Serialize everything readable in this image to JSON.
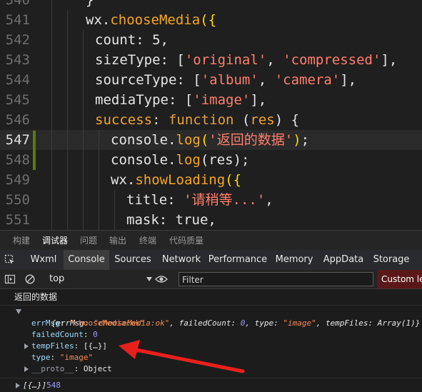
{
  "editor": {
    "lines": [
      {
        "num": "540",
        "tokens": [
          {
            "t": "}",
            "c": "p"
          }
        ]
      },
      {
        "num": "541",
        "tokens": [
          {
            "t": "wx.",
            "c": "p"
          },
          {
            "t": "chooseMedia",
            "c": "f"
          },
          {
            "t": "({",
            "c": "br"
          }
        ]
      },
      {
        "num": "542",
        "tokens": [
          {
            "t": "count",
            "c": "pr"
          },
          {
            "t": ": ",
            "c": "p"
          },
          {
            "t": "5",
            "c": "n"
          },
          {
            "t": ",",
            "c": "p"
          }
        ]
      },
      {
        "num": "543",
        "tokens": [
          {
            "t": "sizeType",
            "c": "pr"
          },
          {
            "t": ": [",
            "c": "p"
          },
          {
            "t": "'original'",
            "c": "s"
          },
          {
            "t": ", ",
            "c": "p"
          },
          {
            "t": "'compressed'",
            "c": "s"
          },
          {
            "t": "],",
            "c": "p"
          }
        ]
      },
      {
        "num": "544",
        "tokens": [
          {
            "t": "sourceType",
            "c": "pr"
          },
          {
            "t": ": [",
            "c": "p"
          },
          {
            "t": "'album'",
            "c": "s"
          },
          {
            "t": ", ",
            "c": "p"
          },
          {
            "t": "'camera'",
            "c": "s"
          },
          {
            "t": "],",
            "c": "p"
          }
        ]
      },
      {
        "num": "545",
        "tokens": [
          {
            "t": "mediaType",
            "c": "pr"
          },
          {
            "t": ": [",
            "c": "p"
          },
          {
            "t": "'image'",
            "c": "s"
          },
          {
            "t": "],",
            "c": "p"
          }
        ]
      },
      {
        "num": "546",
        "tokens": [
          {
            "t": "success",
            "c": "f"
          },
          {
            "t": ": ",
            "c": "p"
          },
          {
            "t": "function",
            "c": "kw"
          },
          {
            "t": " (",
            "c": "p"
          },
          {
            "t": "res",
            "c": "f"
          },
          {
            "t": ") {",
            "c": "p"
          }
        ]
      },
      {
        "num": "547",
        "tokens": [
          {
            "t": "console.",
            "c": "p"
          },
          {
            "t": "log",
            "c": "f"
          },
          {
            "t": "(",
            "c": "br"
          },
          {
            "t": "'返回的数据'",
            "c": "s"
          },
          {
            "t": ")",
            "c": "br"
          },
          {
            "t": ";",
            "c": "p"
          }
        ]
      },
      {
        "num": "548",
        "tokens": [
          {
            "t": "console.",
            "c": "p"
          },
          {
            "t": "log",
            "c": "f"
          },
          {
            "t": "(res);",
            "c": "p"
          }
        ]
      },
      {
        "num": "549",
        "tokens": [
          {
            "t": "wx.",
            "c": "p"
          },
          {
            "t": "showLoading",
            "c": "f"
          },
          {
            "t": "({",
            "c": "br"
          }
        ]
      },
      {
        "num": "550",
        "tokens": [
          {
            "t": "title",
            "c": "pr"
          },
          {
            "t": ": ",
            "c": "p"
          },
          {
            "t": "'请稍等...'",
            "c": "s"
          },
          {
            "t": ",",
            "c": "p"
          }
        ]
      },
      {
        "num": "551",
        "tokens": [
          {
            "t": "mask",
            "c": "pr"
          },
          {
            "t": ": ",
            "c": "p"
          },
          {
            "t": "true",
            "c": "n"
          },
          {
            "t": ",",
            "c": "p"
          }
        ]
      }
    ]
  },
  "panel_tabs": [
    "构建",
    "调试器",
    "问题",
    "输出",
    "终端",
    "代码质量"
  ],
  "devtools_tabs": [
    "Wxml",
    "Console",
    "Sources",
    "Network",
    "Performance",
    "Memory",
    "AppData",
    "Storage"
  ],
  "toolbar": {
    "context": "top",
    "filter_placeholder": "Filter",
    "levels_label": "Custom lev"
  },
  "console": {
    "log_text": "返回的数据",
    "obj_open": "{",
    "errMsg_key": "errMsg",
    "errMsg_value": "\"chooseMedia:ok\"",
    "failedCount_key": "failedCount",
    "failedCount_value": "0",
    "type_key": "type",
    "type_value": "\"image\"",
    "tempFiles_key": "tempFiles",
    "tempFiles_value": "Array(1)",
    "obj_close": "}",
    "prop_errMsg": "errMsg",
    "prop_errMsg_val": "\"chooseMedia:ok\"",
    "prop_failed": "failedCount",
    "prop_failed_val": "0",
    "prop_temp": "tempFiles",
    "prop_temp_val": "[{…}]",
    "prop_type": "type",
    "prop_type_val": "\"image\"",
    "prop_proto": "__proto__",
    "prop_proto_val": "Object",
    "last_array": "[{…}]",
    "last_num": "548"
  },
  "icons": {
    "inspect": "inspect-icon",
    "sidebar": "sidebar-toggle-icon",
    "clear": "clear-console-icon",
    "eye": "eye-icon",
    "arrow": "red-annotation-arrow"
  }
}
